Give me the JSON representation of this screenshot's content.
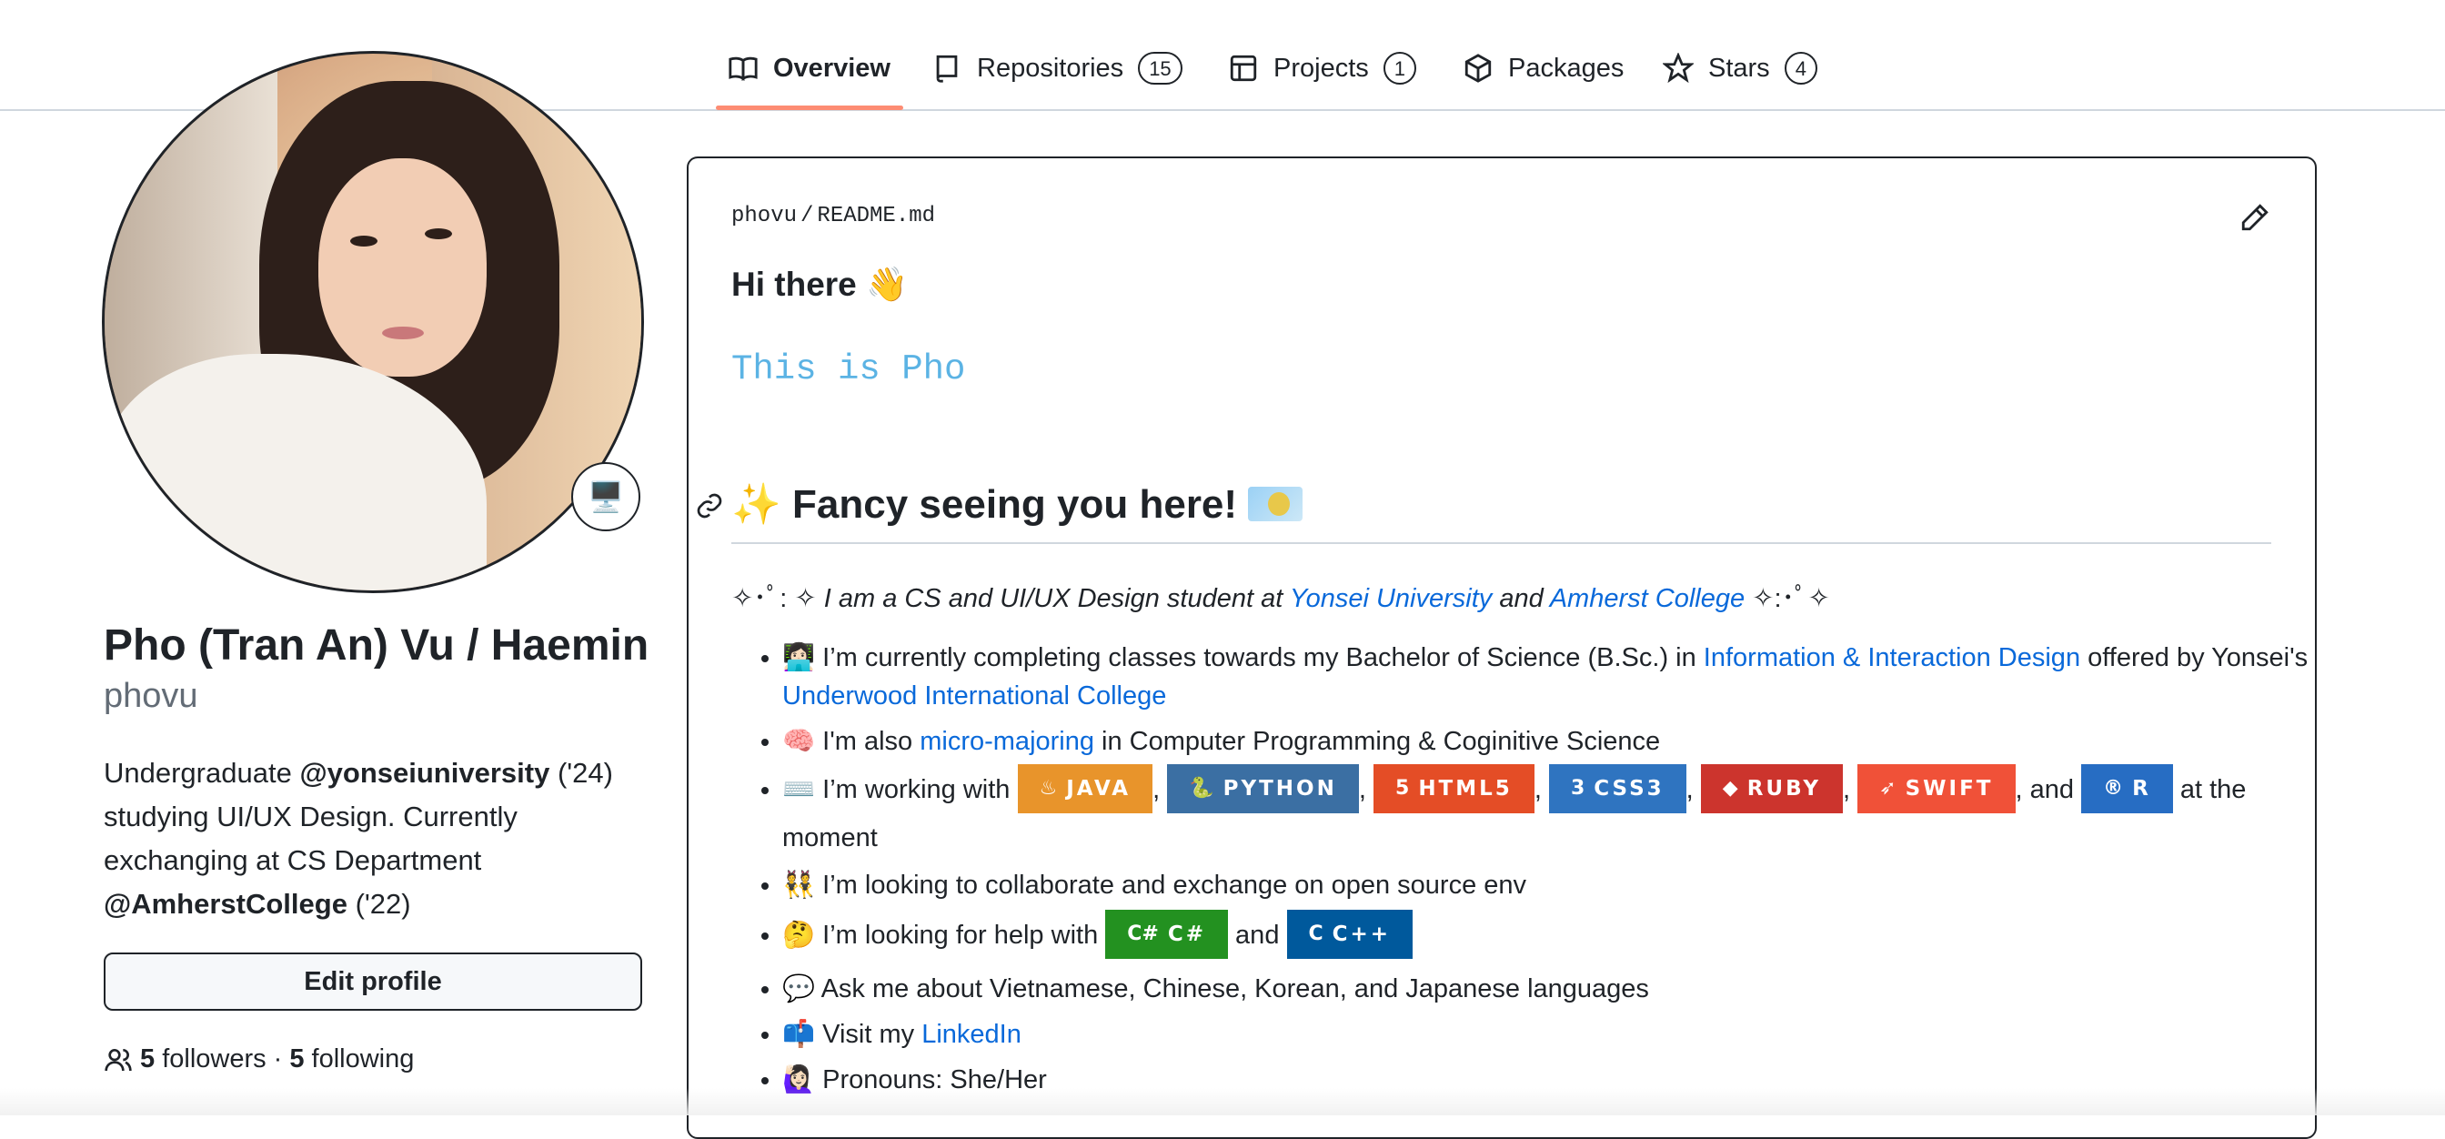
{
  "nav": {
    "tabs": [
      {
        "label": "Overview"
      },
      {
        "label": "Repositories",
        "count": "15"
      },
      {
        "label": "Projects",
        "count": "1"
      },
      {
        "label": "Packages"
      },
      {
        "label": "Stars",
        "count": "4"
      }
    ],
    "accent_color": "#fd8c73"
  },
  "profile": {
    "status_emoji": "🖥️",
    "fullname": "Pho (Tran An) Vu / Haemin",
    "username": "phovu",
    "bio": {
      "t1": "Undergraduate ",
      "m1": "@yonseiuniversity",
      "t2": " ('24) studying UI/UX Design. Currently exchanging at CS Department ",
      "m2": "@AmherstCollege",
      "t3": " ('22)"
    },
    "edit_label": "Edit profile",
    "followers_count": "5",
    "followers_label": "followers",
    "sep": "·",
    "following_count": "5",
    "following_label": "following"
  },
  "readme": {
    "owner": "phovu",
    "slash": "/",
    "file": "README.md",
    "greeting": "Hi there 👋",
    "typing_text": "This is Pho",
    "heading": "✨ Fancy seeing you here!",
    "tagline": {
      "pre": "✧･ﾟ: ✧",
      "t1": "I am a CS and UI/UX Design student at ",
      "l1": "Yonsei University",
      "t2": " and ",
      "l2": "Amherst College",
      "post": " ✧:･ﾟ✧"
    },
    "items": {
      "i1": {
        "t1": "👩🏻‍💻 I’m currently completing classes towards my Bachelor of Science (B.Sc.) in ",
        "l1": "Information & Interaction Design",
        "t2": " offered by Yonsei's ",
        "l2": "Underwood International College"
      },
      "i2": {
        "t1": "🧠 I'm also ",
        "l1": "micro-majoring",
        "t2": " in Computer Programming & Coginitive Science"
      },
      "i3": {
        "t1": "⌨️ I’m working with ",
        "badges": [
          {
            "icon": "♨",
            "label": "JAVA"
          },
          {
            "icon": "🐍",
            "label": "PYTHON"
          },
          {
            "icon": "5",
            "label": "HTML5"
          },
          {
            "icon": "3",
            "label": "CSS3"
          },
          {
            "icon": "◆",
            "label": "RUBY"
          },
          {
            "icon": "➶",
            "label": "SWIFT"
          },
          {
            "icon": "®",
            "label": "R"
          }
        ],
        "comma": ",",
        "and": ", and ",
        "t2": " at the moment"
      },
      "i4": {
        "t1": "👯 I’m looking to collaborate and exchange on open source env"
      },
      "i5": {
        "t1": "🤔 I’m looking for help with ",
        "badges": [
          {
            "icon": "C#",
            "label": "C#"
          },
          {
            "icon": "C",
            "label": "C++"
          }
        ],
        "and": " and "
      },
      "i6": {
        "t1": "💬 Ask me about Vietnamese, Chinese, Korean, and Japanese languages"
      },
      "i7": {
        "t1": "📫 Visit my ",
        "l1": "LinkedIn"
      },
      "i8": {
        "t1": "🙋🏻‍♀️ Pronouns: She/Her"
      }
    }
  }
}
